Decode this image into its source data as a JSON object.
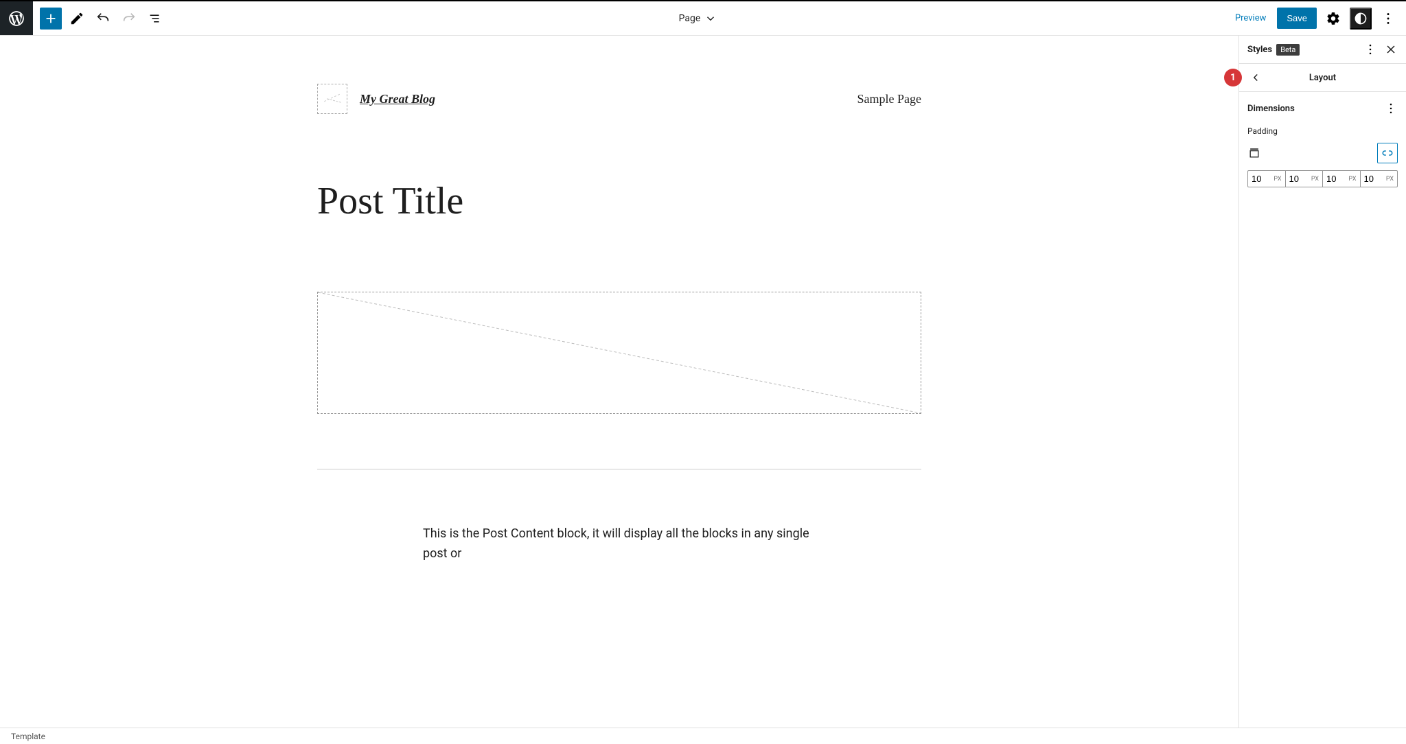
{
  "topbar": {
    "doc_type": "Page",
    "preview": "Preview",
    "save": "Save"
  },
  "canvas": {
    "site_title": "My Great Blog",
    "nav_item": "Sample Page",
    "post_title": "Post Title",
    "post_content": "This is the Post Content block, it will display all the blocks in any single post or"
  },
  "sidebar": {
    "title": "Styles",
    "beta": "Beta",
    "section": "Layout",
    "callout": "1",
    "dimensions": {
      "label": "Dimensions",
      "padding_label": "Padding",
      "unit": "PX",
      "values": {
        "top": "10",
        "right": "10",
        "bottom": "10",
        "left": "10"
      }
    }
  },
  "footer": {
    "breadcrumb": "Template"
  }
}
